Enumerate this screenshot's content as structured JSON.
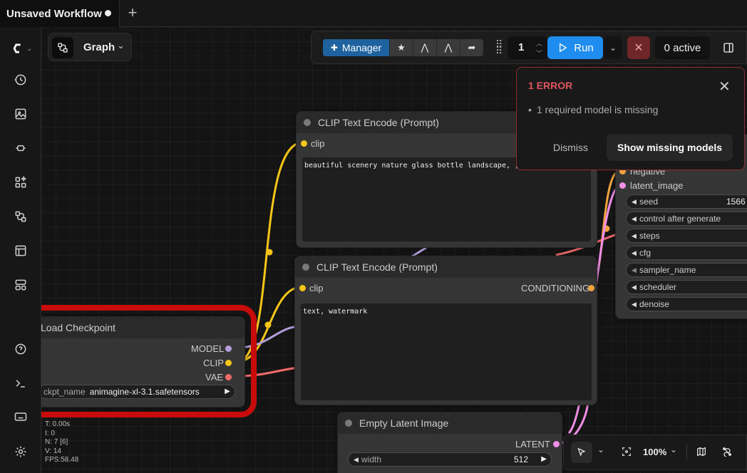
{
  "tab": {
    "title": "Unsaved Workflow"
  },
  "graph_selector": {
    "label": "Graph"
  },
  "toolbar": {
    "manager_label": "Manager",
    "queue_count": "1",
    "run_label": "Run",
    "active_label": "0 active"
  },
  "error_popup": {
    "title": "1 ERROR",
    "message": "1 required model is missing",
    "dismiss_label": "Dismiss",
    "show_label": "Show missing models"
  },
  "nodes": {
    "clip_top": {
      "title": "CLIP Text Encode (Prompt)",
      "input_clip": "clip",
      "text": "beautiful scenery nature glass bottle landscape, , pur"
    },
    "clip_bottom": {
      "title": "CLIP Text Encode (Prompt)",
      "input_clip": "clip",
      "output": "CONDITIONING",
      "text": "text, watermark"
    },
    "checkpoint": {
      "title": "Load Checkpoint",
      "out_model": "MODEL",
      "out_clip": "CLIP",
      "out_vae": "VAE",
      "widget_name": "ckpt_name",
      "widget_value": "animagine-xl-3.1.safetensors"
    },
    "latent": {
      "title": "Empty Latent Image",
      "output": "LATENT",
      "width_label": "width",
      "width_value": "512"
    },
    "sampler": {
      "input_negative": "negative",
      "input_latent": "latent_image",
      "seed_label": "seed",
      "seed_value": "1566",
      "control_label": "control after generate",
      "steps_label": "steps",
      "cfg_label": "cfg",
      "sampler_label": "sampler_name",
      "scheduler_label": "scheduler",
      "denoise_label": "denoise"
    }
  },
  "stats": {
    "t": "T: 0.00s",
    "i": "I: 0",
    "n": "N: 7 [6]",
    "v": "V: 14",
    "fps": "FPS:58.48"
  },
  "bottom_controls": {
    "zoom": "100%"
  },
  "colors": {
    "clip": "#f5c518",
    "model": "#b39ddb",
    "vae": "#f06a6a",
    "conditioning": "#f0a23c",
    "latent": "#f08ee8",
    "run": "#1f8cf0",
    "manager": "#1e62a0",
    "error": "#e0565e"
  }
}
